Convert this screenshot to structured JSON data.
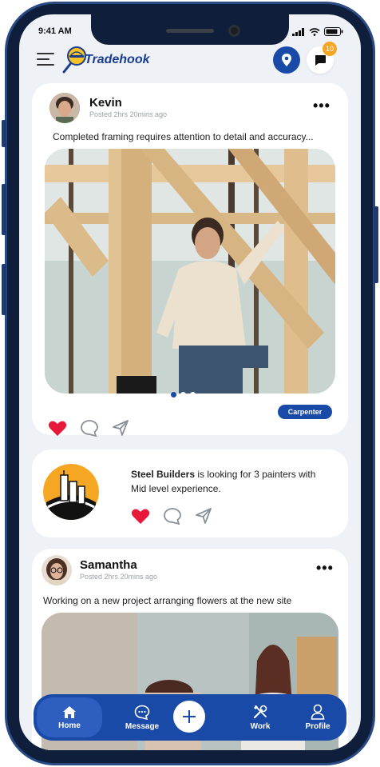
{
  "status_bar": {
    "time": "9:41 AM"
  },
  "header": {
    "logo_text": "Tradehook",
    "notification_count": "10"
  },
  "posts": [
    {
      "author": "Kevin",
      "meta": "Posted 2hrs 20mins ago",
      "text": "Completed framing requires attention to detail and accuracy...",
      "tag": "Carpenter"
    },
    {
      "author": "Samantha",
      "meta": "Posted 2hrs 20mins ago",
      "text": "Working on a new project arranging flowers at the new site"
    }
  ],
  "job_post": {
    "company": "Steel Builders",
    "text_1": " is looking for 3 painters with",
    "text_2": "Mid level experience."
  },
  "nav": {
    "home": "Home",
    "message": "Message",
    "work": "Work",
    "profile": "Profile"
  },
  "colors": {
    "brand": "#1a4aa8",
    "badge": "#f5a623",
    "like": "#e8183a"
  }
}
